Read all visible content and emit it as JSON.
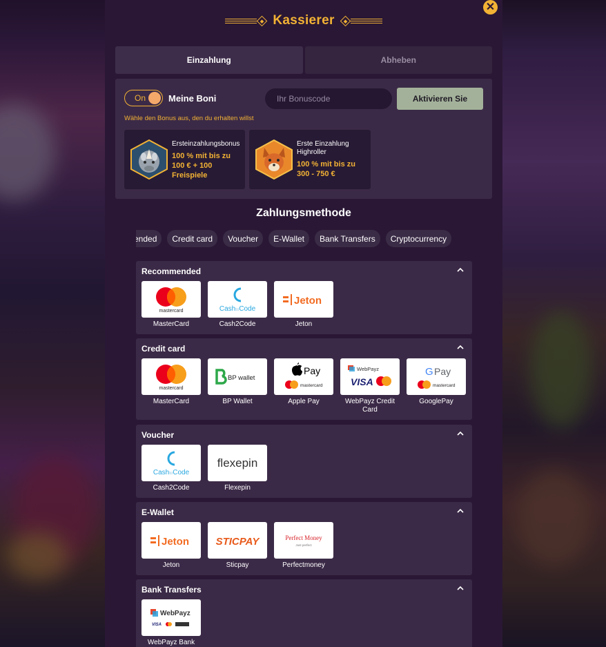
{
  "header": {
    "title": "Kassierer"
  },
  "close_label": "✕",
  "tabs": [
    {
      "label": "Einzahlung"
    },
    {
      "label": "Abheben"
    }
  ],
  "bonus": {
    "toggle_label": "On",
    "label": "Meine Boni",
    "code_placeholder": "Ihr Bonuscode",
    "activate_label": "Aktivieren Sie",
    "hint": "Wähle den Bonus aus, den du erhalten willst",
    "cards": [
      {
        "name": "Ersteinzahlungsbonus",
        "offer_lines": [
          "100 % mit bis zu",
          "100 € + 100",
          "Freispiele"
        ]
      },
      {
        "name_lines": [
          "Erste Einzahlung",
          "Highroller"
        ],
        "offer_lines": [
          "100 % mit bis zu",
          "300 - 750 €"
        ]
      }
    ]
  },
  "section_title": "Zahlungsmethode",
  "chips": [
    "mended",
    "Credit card",
    "Voucher",
    "E-Wallet",
    "Bank Transfers",
    "Cryptocurrency"
  ],
  "categories": [
    {
      "title": "Recommended",
      "methods": [
        {
          "label": "MasterCard",
          "icon": "mastercard-logo"
        },
        {
          "label": "Cash2Code",
          "icon": "cash2code-logo"
        },
        {
          "label": "Jeton",
          "icon": "jeton-logo"
        }
      ]
    },
    {
      "title": "Credit card",
      "methods": [
        {
          "label": "MasterCard",
          "icon": "mastercard-logo"
        },
        {
          "label": "BP Wallet",
          "icon": "bp-wallet-logo"
        },
        {
          "label": "Apple Pay",
          "icon": "apple-pay-logo"
        },
        {
          "label": "WebPayz Credit Card",
          "label_lines": [
            "WebPayz Credit",
            "Card"
          ],
          "icon": "webpayz-logo"
        },
        {
          "label": "GooglePay",
          "icon": "google-pay-logo"
        }
      ]
    },
    {
      "title": "Voucher",
      "methods": [
        {
          "label": "Cash2Code",
          "icon": "cash2code-logo"
        },
        {
          "label": "Flexepin",
          "icon": "flexepin-logo"
        }
      ]
    },
    {
      "title": "E-Wallet",
      "methods": [
        {
          "label": "Jeton",
          "icon": "jeton-logo"
        },
        {
          "label": "Sticpay",
          "icon": "sticpay-logo"
        },
        {
          "label": "Perfectmoney",
          "icon": "perfect-money-logo"
        }
      ]
    },
    {
      "title": "Bank Transfers",
      "methods": [
        {
          "label": "WebPayz Bank",
          "icon": "webpayz-bank-logo"
        }
      ]
    }
  ],
  "logo_text": {
    "mastercard": "mastercard",
    "cash2code_a": "Cash",
    "cash2code_b": "to",
    "cash2code_c": "Code",
    "jeton": "Jeton",
    "bp_wallet": "BP wallet",
    "apple_pay": "Pay",
    "webpayz": "WebPayz",
    "visa": "VISA",
    "google_pay": "Pay",
    "flexepin": "flexepin",
    "sticpay": "STICPAY",
    "perfect_money": "Perfect Money",
    "perfect_money_sub": "Just perfect"
  },
  "colors": {
    "accent": "#f2b234",
    "modal_bg": "#2a1735",
    "panel_bg": "#3b2a47",
    "activate_bg": "#a3b19a"
  }
}
